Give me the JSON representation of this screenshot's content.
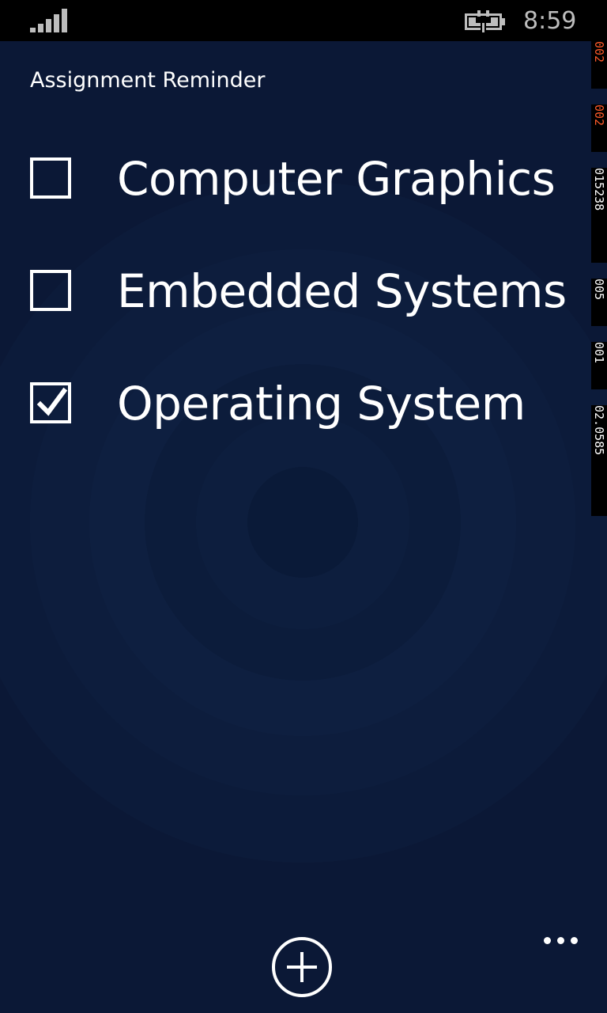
{
  "status_bar": {
    "time": "8:59",
    "signal_icon": "signal-strength-icon",
    "battery_icon": "battery-charging-icon"
  },
  "frame_counters": [
    {
      "text": "002",
      "color": "#ff5a2a"
    },
    {
      "text": "002",
      "color": "#ff5a2a"
    },
    {
      "text": "015238",
      "color": "#ffffff"
    },
    {
      "text": "005",
      "color": "#ffffff"
    },
    {
      "text": "001",
      "color": "#ffffff"
    },
    {
      "text": "02.0585",
      "color": "#ffffff"
    }
  ],
  "app": {
    "title": "Assignment Reminder"
  },
  "tasks": [
    {
      "label": "Computer Graphics",
      "checked": false
    },
    {
      "label": "Embedded Systems",
      "checked": false
    },
    {
      "label": "Operating System",
      "checked": true
    }
  ],
  "app_bar": {
    "add_icon": "add-icon",
    "more_icon": "more-options-icon"
  },
  "colors": {
    "background": "#0b1836",
    "foreground": "#ffffff",
    "status_bar": "#000000"
  }
}
